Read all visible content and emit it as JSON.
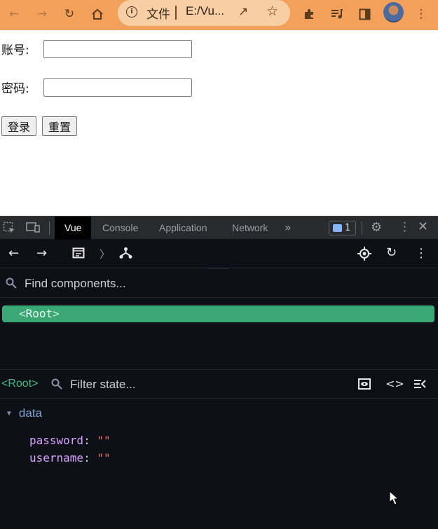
{
  "browser": {
    "scheme_label": "文件",
    "url": "E:/Vu...",
    "nav_icons": [
      "back-arrow-icon",
      "forward-arrow-icon",
      "reload-icon",
      "home-icon"
    ],
    "accent_color": "#f3a05a"
  },
  "page": {
    "account_label": "账号:",
    "password_label": "密码:",
    "login_button": "登录",
    "reset_button": "重置"
  },
  "devtools": {
    "tabs": [
      "Vue",
      "Console",
      "Application",
      "Network"
    ],
    "active_tab": "Vue",
    "issues_count": "1"
  },
  "vue": {
    "find_placeholder": "Find components...",
    "root_component": "Root",
    "selected_component": "<Root>",
    "filter_placeholder": "Filter state...",
    "section_title": "data",
    "props": [
      {
        "key": "password",
        "value": "\"\""
      },
      {
        "key": "username",
        "value": "\"\""
      }
    ]
  }
}
